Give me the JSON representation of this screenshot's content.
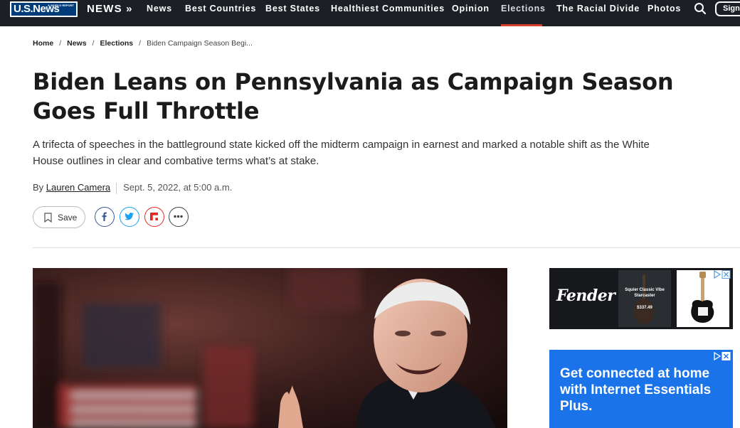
{
  "nav": {
    "logo_text": "U.S.News",
    "logo_tagline": "& WORLD REPORT",
    "news_label": "NEWS »",
    "links": [
      {
        "label": "News"
      },
      {
        "label": "Best Countries"
      },
      {
        "label": "Best States"
      },
      {
        "label": "Healthiest Communities"
      },
      {
        "label": "Opinion"
      },
      {
        "label": "Elections",
        "active": true
      },
      {
        "label": "The Racial Divide"
      },
      {
        "label": "Photos"
      }
    ],
    "search_icon": "search-icon",
    "sign_label": "Sign",
    "accent_color": "#d33f2b",
    "background_color": "#1c1f26"
  },
  "breadcrumb": {
    "items": [
      "Home",
      "News",
      "Elections"
    ],
    "current": "Biden Campaign Season Begi..."
  },
  "article": {
    "headline": "Biden Leans on Pennsylvania as Campaign Season Goes Full Throttle",
    "dek": "A trifecta of speeches in the battleground state kicked off the midterm campaign in earnest and marked a notable shift as the White House outlines in clear and combative terms what’s at stake.",
    "byline_prefix": "By",
    "author": "Lauren Camera",
    "date": "Sept. 5, 2022, at 5:00 a.m."
  },
  "share": {
    "save_label": "Save",
    "icons": [
      "facebook-icon",
      "twitter-icon",
      "flipboard-icon",
      "more-icon"
    ],
    "colors": {
      "facebook": "#3b5998",
      "twitter": "#1da1f2",
      "flipboard": "#e12828"
    }
  },
  "ads": {
    "fender": {
      "brand": "Fender",
      "product_name": "Squier Classic Vibe Starcaster",
      "product_price": "$337.49"
    },
    "comcast": {
      "text": "Get connected at home with Internet Essentials Plus.",
      "color": "#1a73e8"
    }
  }
}
